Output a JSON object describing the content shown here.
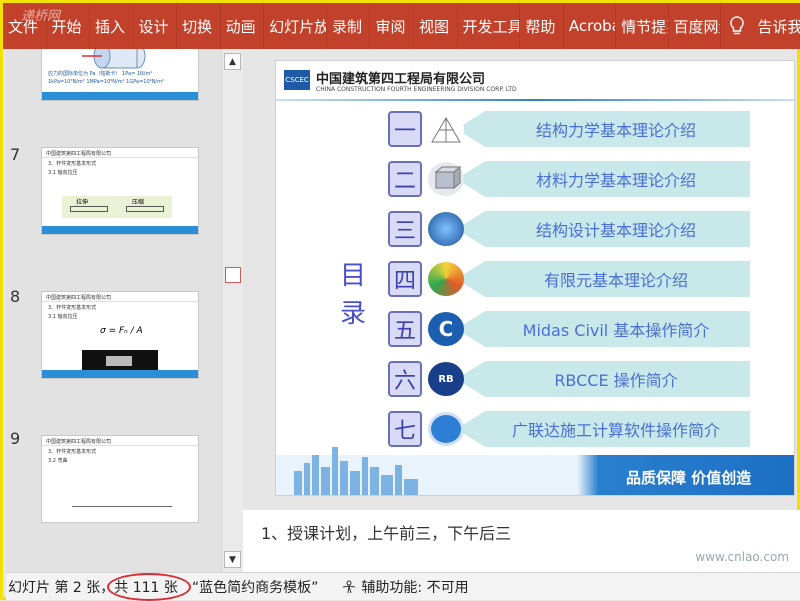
{
  "ribbon": {
    "watermark": "递桥网",
    "tabs": [
      "文件",
      "开始",
      "插入",
      "设计",
      "切换",
      "动画",
      "幻灯片放映",
      "录制",
      "审阅",
      "视图",
      "开发工具",
      "帮助",
      "Acrobat",
      "情节提要",
      "百度网盘"
    ],
    "tell_me": "告诉我"
  },
  "thumbnails": [
    {
      "number": "",
      "header": "",
      "line1": "应力的国际单位为 Pa（帕斯卡） 1Pa= 1N/m²",
      "line2": "1kPa=10³N/m²  1MPa=10⁶N/m²  1GPa=10⁹N/m²"
    },
    {
      "number": "7",
      "header": "中国建筑第四工程局有限公司",
      "line1": "3、杆件变形基本形式",
      "line2": "3.1 轴向拉压",
      "labels": [
        "拉伸",
        "压缩"
      ]
    },
    {
      "number": "8",
      "header": "中国建筑第四工程局有限公司",
      "line1": "3、杆件变形基本形式",
      "line2": "3.1 轴向拉压",
      "formula": "σ = Fₙ / A"
    },
    {
      "number": "9",
      "header": "中国建筑第四工程局有限公司",
      "line1": "3、杆件变形基本形式",
      "line2": "3.2 弯曲"
    }
  ],
  "slide": {
    "company_cn": "中国建筑第四工程局有限公司",
    "company_en": "CHINA CONSTRUCTION FOURTH ENGINEERING DIVISION CORP. LTD",
    "logo": "CSCEC",
    "toc_title": [
      "目",
      "录"
    ],
    "items": [
      {
        "num": "一",
        "text": "结构力学基本理论介绍",
        "color": "#8fa0c8"
      },
      {
        "num": "二",
        "text": "材料力学基本理论介绍",
        "color": "#c9ccd4"
      },
      {
        "num": "三",
        "text": "结构设计基本理论介绍",
        "color": "#3a7fd0"
      },
      {
        "num": "四",
        "text": "有限元基本理论介绍",
        "color": "#e0592a"
      },
      {
        "num": "五",
        "text": "Midas Civil 基本操作简介",
        "color": "#1c5fb0"
      },
      {
        "num": "六",
        "text": "RBCCE 操作简介",
        "color": "#1a3f8a"
      },
      {
        "num": "七",
        "text": "广联达施工计算软件操作简介",
        "color": "#2f7ed6"
      }
    ],
    "slogan": "品质保障  价值创造"
  },
  "notes": {
    "text": "1、授课计划，上午前三，下午后三",
    "watermark": "www.cnlao.com"
  },
  "status": {
    "slide_info": "幻灯片 第 2 张，共 111 张",
    "template": "“蓝色简约商务模板”",
    "accessibility": "辅助功能: 不可用"
  }
}
